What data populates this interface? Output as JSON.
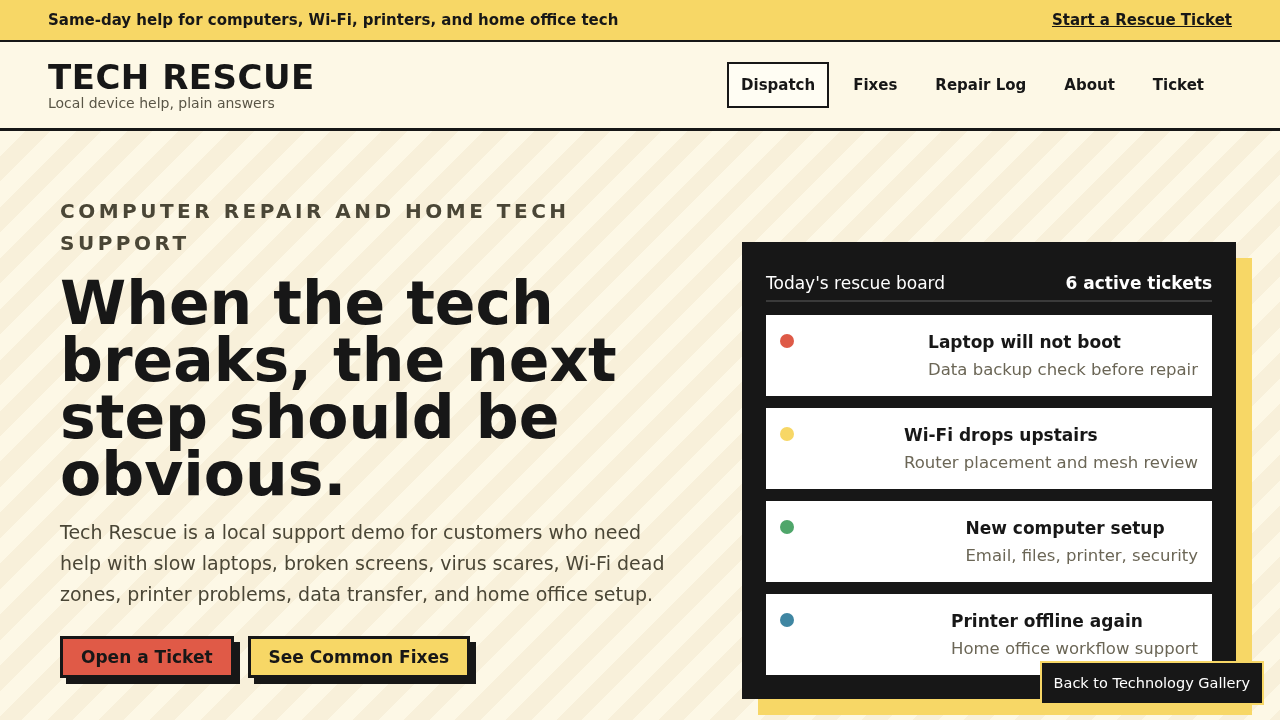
{
  "top_bar": {
    "message": "Same-day help for computers, Wi-Fi, printers, and home office tech",
    "link": "Start a Rescue Ticket"
  },
  "header": {
    "logo": "TECH RESCUE",
    "tagline": "Local device help, plain answers",
    "nav": [
      {
        "label": "Dispatch",
        "selected": true
      },
      {
        "label": "Fixes",
        "selected": false
      },
      {
        "label": "Repair Log",
        "selected": false
      },
      {
        "label": "About",
        "selected": false
      },
      {
        "label": "Ticket",
        "selected": false
      }
    ]
  },
  "hero": {
    "eyebrow": "COMPUTER REPAIR AND HOME TECH SUPPORT",
    "heading": "When the tech breaks, the next step should be obvious.",
    "intro": "Tech Rescue is a local support demo for customers who need help with slow laptops, broken screens, virus scares, Wi-Fi dead zones, printer problems, data transfer, and home office setup.",
    "buttons": [
      {
        "label": "Open a Ticket",
        "kind": "primary"
      },
      {
        "label": "See Common Fixes",
        "kind": "secondary"
      }
    ]
  },
  "board": {
    "title": "Today's rescue board",
    "count": "6 active tickets",
    "tickets": [
      {
        "title": "Laptop will not boot",
        "detail": "Data backup check before repair",
        "color": "#de5a47"
      },
      {
        "title": "Wi-Fi drops upstairs",
        "detail": "Router placement and mesh review",
        "color": "#f7d766"
      },
      {
        "title": "New computer setup",
        "detail": "Email, files, printer, security",
        "color": "#4fa66a"
      },
      {
        "title": "Printer offline again",
        "detail": "Home office workflow support",
        "color": "#3f86a2"
      }
    ]
  },
  "gallery_link": "Back to Technology Gallery"
}
